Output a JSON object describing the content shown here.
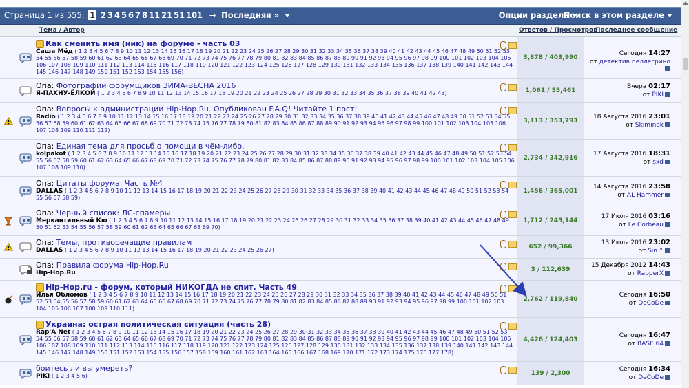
{
  "pagination": {
    "label": "Страница 1 из 555:",
    "current": "1",
    "pages": [
      "2",
      "3",
      "4",
      "5",
      "6",
      "7",
      "8",
      "11",
      "21",
      "51",
      "101"
    ],
    "arrow": "→",
    "last": "Последняя »"
  },
  "header": {
    "options": "Опции раздела",
    "search": "Поиск в этом разделе"
  },
  "columns": {
    "topic": "Тема / Автор",
    "replies": "Ответов / Просмотров",
    "last_post": "Последнее сообщение"
  },
  "colors": {
    "header_bg": "#3c5d93",
    "link": "#22229c",
    "stats": "#3a7a2a",
    "stats_bg": "#e1e4f2"
  },
  "threads": [
    {
      "status_icon": "",
      "thread_icon": "hot-thread-icon",
      "prefix": "",
      "sticky_star": true,
      "title": "Как сменить имя (ник) на форуме - часть 03",
      "bold": true,
      "author": "Саша Мёд",
      "pages": "( 1 2 3 4 5 6 7 8 9 10 11 12 13 14 15 16 17 18 19 20 21 22 23 24 25 26 27 28 29 30 31 32 33 34 35 36 37 38 39 40 41 42 43 44 45 46 47 48 49 50 51 52 53 54 55 56 57 58 59 60 61 62 63 64 65 66 67 68 69 70 71 72 73 74 75 76 77 78 79 80 81 82 83 84 85 86 87 88 89 90 91 92 93 94 95 96 97 98 99 100 101 102 103 104 105 106 107 108 109 110 111 112 113 114 115 116 117 118 119 120 121 122 123 124 125 126 127 128 129 130 131 132 133 134 135 136 137 138 139 140 141 142 143 144 145 146 147 148 149 150 151 152 153 154 155 156)",
      "stats": "3,878 / 403,990",
      "last_date": "Сегодня",
      "last_time": "14:27",
      "last_user": "детектив пеллегрино",
      "height": 61
    },
    {
      "status_icon": "",
      "thread_icon": "thread-icon",
      "prefix": "Опа:",
      "sticky_star": false,
      "title": "Фотографии форумщиков ЗИМА-ВЕСНА 2016",
      "bold": false,
      "author": "Я-ПАХНУ-ЁЛКОЙ",
      "pages": "( 1 2 3 4 5 6 7 8 9 10 11 12 13 14 15 16 17 18 19 20 21 22 23 24 25 26 27 28 29 30 31 32 33 34 35 36 37 38 39 40 41 42 43)",
      "stats": "1,061 / 55,461",
      "last_date": "Вчера",
      "last_time": "02:17",
      "last_user": "PIKI",
      "height": 34
    },
    {
      "status_icon": "warning-icon",
      "thread_icon": "hot-thread-icon",
      "prefix": "Опа:",
      "sticky_star": false,
      "title": "Вопросы к администрации Hip-Hop.Ru. Опубликован F.A.Q! Читайте 1 пост!",
      "bold": false,
      "author": "Radio",
      "pages": "( 1 2 3 4 5 6 7 8 9 10 11 12 13 14 15 16 17 18 19 20 21 22 23 24 25 26 27 28 29 30 31 32 33 34 35 36 37 38 39 40 41 42 43 44 45 46 47 48 49 50 51 52 53 54 55 56 57 58 59 60 61 62 63 64 65 66 67 68 69 70 71 72 73 74 75 76 77 78 79 80 81 82 83 84 85 86 87 88 89 90 91 92 93 94 95 96 97 98 99 100 101 102 103 104 105 106 107 108 109 110 111 112)",
      "stats": "3,113 / 353,793",
      "last_date": "18 Августа 2016",
      "last_time": "23:01",
      "last_user": "Skiminok",
      "height": 54
    },
    {
      "status_icon": "",
      "thread_icon": "hot-thread-icon",
      "prefix": "Опа:",
      "sticky_star": false,
      "title": "Единая тема для просьб о помощи в чём-либо.",
      "bold": false,
      "author": "kolpakot",
      "pages": "( 1 2 3 4 5 6 7 8 9 10 11 12 13 14 15 16 17 18 19 20 21 22 23 24 25 26 27 28 29 30 31 32 33 34 35 36 37 38 39 40 41 42 43 44 45 46 47 48 49 50 51 52 53 54 55 56 57 58 59 60 61 62 63 64 65 66 67 68 69 70 71 72 73 74 75 76 77 78 79 80 81 82 83 84 85 86 87 88 89 90 91 92 93 94 95 96 97 98 99 100 101 102 103 104 105 106 107 108 109 110)",
      "stats": "2,734 / 342,916",
      "last_date": "17 Августа 2016",
      "last_time": "18:31",
      "last_user": "sxd",
      "height": 54
    },
    {
      "status_icon": "",
      "thread_icon": "hot-thread-icon",
      "prefix": "Опа:",
      "sticky_star": false,
      "title": "Цитаты форума. Часть №4",
      "bold": false,
      "author": "DALLAS",
      "pages": "( 1 2 3 4 5 6 7 8 9 10 11 12 13 14 15 16 17 18 19 20 21 22 23 24 25 26 27 28 29 30 31 32 33 34 35 36 37 38 39 40 41 42 43 44 45 46 47 48 49 50 51 52 53 54 55 56 57 58 59)",
      "stats": "1,456 / 365,001",
      "last_date": "14 Августа 2016",
      "last_time": "23:58",
      "last_user": "AL Hammer",
      "height": 43
    },
    {
      "status_icon": "cup-icon",
      "thread_icon": "hot-thread-icon",
      "prefix": "Опа:",
      "sticky_star": false,
      "title": "Черный список: ЛС-спамеры",
      "bold": false,
      "author": "Меркантильный Кю",
      "pages": "( 1 2 3 4 5 6 7 8 9 10 11 12 13 14 15 16 17 18 19 20 21 22 23 24 25 26 27 28 29 30 31 32 33 34 35 36 37 38 39 40 41 42 43 44 45 46 47 48 49 50 51 52 53 54 55 56 57 58 59 60 61 62 63 64 65 66 67 68 69 70)",
      "stats": "1,712 / 245,144",
      "last_date": "17 Июля 2016",
      "last_time": "03:16",
      "last_user": "Le Corbeau",
      "height": 43
    },
    {
      "status_icon": "warning-icon",
      "thread_icon": "thread-icon",
      "prefix": "Опа:",
      "sticky_star": false,
      "title": "Темы, противоречащие правилам",
      "bold": false,
      "author": "DALLAS",
      "pages": "( 1 2 3 4 5 6 7 8 9 10 11 12 13 14 15 16 17 18 19 20 21 22 23 24 25 26 27)",
      "stats": "652 / 99,366",
      "last_date": "13 Июля 2016",
      "last_time": "23:02",
      "last_user": "Sin™",
      "height": 33
    },
    {
      "status_icon": "",
      "thread_icon": "locked-thread-icon",
      "prefix": "Опа:",
      "sticky_star": false,
      "title": "Правила форума Hip-Hop.Ru",
      "bold": false,
      "author": "Hip-Hop.Ru",
      "pages": "",
      "stats": "3 / 112,639",
      "last_date": "15 Декабря 2012",
      "last_time": "14:43",
      "last_user": "RapperX",
      "height": 32
    },
    {
      "status_icon": "bomb-icon",
      "thread_icon": "hot-thread-icon",
      "prefix": "",
      "sticky_star": true,
      "title": "Hip-Hop.ru - форум, который НИКОГДА не спит. Часть 49",
      "bold": true,
      "author": "Илья Обломов",
      "pages": "( 1 2 3 4 5 6 7 8 9 10 11 12 13 14 15 16 17 18 19 20 21 22 23 24 25 26 27 28 29 30 31 32 33 34 35 36 37 38 39 40 41 42 43 44 45 46 47 48 49 50 51 52 53 54 55 56 57 58 59 60 61 62 63 64 65 66 67 68 69 70 71 72 73 74 75 76 77 78 79 80 81 82 83 84 85 86 87 88 89 90 91 92 93 94 95 96 97 98 99 100 101 102 103 104 105 106 107 108 109 110 111)",
      "stats": "2,762 / 119,840",
      "last_date": "Сегодня",
      "last_time": "16:50",
      "last_user": "DeCoDe",
      "height": 54
    },
    {
      "status_icon": "",
      "thread_icon": "hot-thread-icon",
      "prefix": "",
      "sticky_star": true,
      "title": "Украина: острая политическая ситуация (часть 28)",
      "bold": true,
      "author": "Rap'A Net",
      "pages": "( 1 2 3 4 5 6 7 8 9 10 11 12 13 14 15 16 17 18 19 20 21 22 23 24 25 26 27 28 29 30 31 32 33 34 35 36 37 38 39 40 41 42 43 44 45 46 47 48 49 50 51 52 53 54 55 56 57 58 59 60 61 62 63 64 65 66 67 68 69 70 71 72 73 74 75 76 77 78 79 80 81 82 83 84 85 86 87 88 89 90 91 92 93 94 95 96 97 98 99 100 101 102 103 104 105 106 107 108 109 110 111 112 113 114 115 116 117 118 119 120 121 122 123 124 125 126 127 128 129 130 131 132 133 134 135 136 137 138 139 140 141 142 143 144 145 146 147 148 149 150 151 152 153 154 155 156 157 158 159 160 161 162 163 164 165 166 167 168 169 170 171 172 173 174 175 176 177 178)",
      "stats": "4,426 / 124,403",
      "last_date": "Сегодня",
      "last_time": "16:47",
      "last_user": "BASE 64",
      "height": 64
    },
    {
      "status_icon": "",
      "thread_icon": "hot-thread-icon",
      "prefix": "",
      "sticky_star": false,
      "title": "боитесь ли вы умереть?",
      "bold": false,
      "author": "PIKI",
      "pages": "( 1 2 3 4 5 6)",
      "stats": "139 / 2,300",
      "last_date": "Сегодня",
      "last_time": "16:34",
      "last_user": "DeCoDe",
      "height": 34
    }
  ]
}
